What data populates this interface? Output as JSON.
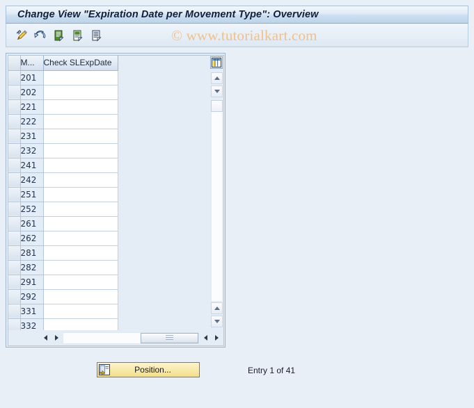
{
  "window": {
    "title": "Change View \"Expiration Date per Movement Type\": Overview"
  },
  "watermark": {
    "text": "© www.tutorialkart.com",
    "color": "#f0c08a"
  },
  "toolbar": {
    "buttons": [
      {
        "name": "pencil-icon",
        "tooltip": "Display/Change"
      },
      {
        "name": "undo-icon",
        "tooltip": "Back"
      },
      {
        "name": "new-entries-icon",
        "tooltip": "New Entries"
      },
      {
        "name": "copy-as-icon",
        "tooltip": "Copy As..."
      },
      {
        "name": "details-icon",
        "tooltip": "Details"
      }
    ]
  },
  "table": {
    "columns": [
      {
        "key": "mvt",
        "label": "M..."
      },
      {
        "key": "check",
        "label": "Check SLExpDate"
      }
    ],
    "rows": [
      {
        "mvt": "201",
        "check": ""
      },
      {
        "mvt": "202",
        "check": ""
      },
      {
        "mvt": "221",
        "check": ""
      },
      {
        "mvt": "222",
        "check": ""
      },
      {
        "mvt": "231",
        "check": ""
      },
      {
        "mvt": "232",
        "check": ""
      },
      {
        "mvt": "241",
        "check": ""
      },
      {
        "mvt": "242",
        "check": ""
      },
      {
        "mvt": "251",
        "check": ""
      },
      {
        "mvt": "252",
        "check": ""
      },
      {
        "mvt": "261",
        "check": ""
      },
      {
        "mvt": "262",
        "check": ""
      },
      {
        "mvt": "281",
        "check": ""
      },
      {
        "mvt": "282",
        "check": ""
      },
      {
        "mvt": "291",
        "check": ""
      },
      {
        "mvt": "292",
        "check": ""
      },
      {
        "mvt": "331",
        "check": ""
      },
      {
        "mvt": "332",
        "check": ""
      }
    ],
    "column_config_icon": "table-settings-icon"
  },
  "footer": {
    "position_button_label": "Position...",
    "position_button_icon": "position-goto-icon",
    "entry_status": "Entry 1 of 41"
  },
  "colors": {
    "page_background": "#e8eff7",
    "title_bar": "#bcd3ea",
    "button_accent": "#f8e9a8",
    "grid_header": "#e2eaf4"
  }
}
